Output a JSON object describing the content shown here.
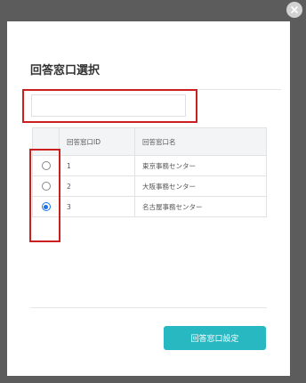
{
  "modal": {
    "title": "回答窓口選択",
    "search": {
      "value": "",
      "placeholder": ""
    },
    "table": {
      "headers": [
        "",
        "回答窓口ID",
        "回答窓口名"
      ],
      "rows": [
        {
          "id": "1",
          "name": "東京事務センター",
          "selected": false
        },
        {
          "id": "2",
          "name": "大阪事務センター",
          "selected": false
        },
        {
          "id": "3",
          "name": "名古屋事務センター",
          "selected": true
        }
      ]
    },
    "submit_label": "回答窓口設定"
  },
  "icons": {
    "close": "close-icon"
  },
  "colors": {
    "overlay": "#5c5c5c",
    "accent_button": "#27b8c2",
    "highlight": "#cc1f1f",
    "radio_selected": "#1a73e8"
  }
}
